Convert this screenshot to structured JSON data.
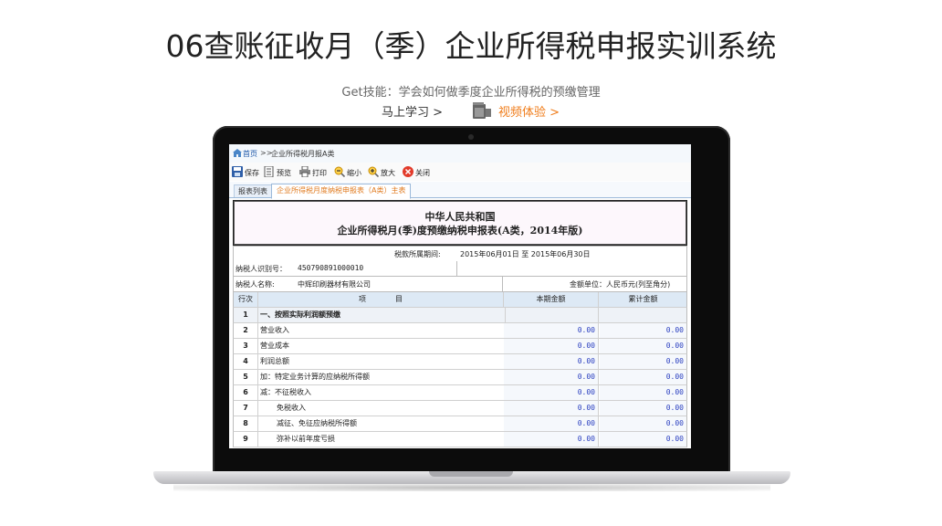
{
  "page": {
    "title": "06查账征收月（季）企业所得税申报实训系统",
    "subtitle": "Get技能：学会如何做季度企业所得税的预缴管理",
    "learn_link": "马上学习 >",
    "video_link": "视频体验 >"
  },
  "colors": {
    "accent": "#f07d1b",
    "link_blue": "#1b56a8",
    "amount_blue": "#2a3fc0"
  },
  "screen": {
    "breadcrumb": {
      "home": "首页",
      "sep": ">>",
      "path": "企业所得税月报A类"
    },
    "toolbar": [
      {
        "icon": "save-icon",
        "label": "保存"
      },
      {
        "icon": "preview-icon",
        "label": "预览"
      },
      {
        "icon": "print-icon",
        "label": "打印"
      },
      {
        "icon": "zoom-out-icon",
        "label": "缩小"
      },
      {
        "icon": "zoom-in-icon",
        "label": "放大"
      },
      {
        "icon": "close-icon",
        "label": "关闭"
      }
    ],
    "tabs": {
      "list": "报表列表",
      "active": "企业所得税月度纳税申报表（A类）主表"
    },
    "form": {
      "header1": "中华人民共和国",
      "header2": "企业所得税月(季)度预缴纳税申报表(A类，2014年版)",
      "period_label": "税款所属期间:",
      "period_value": "2015年06月01日  至  2015年06月30日",
      "taxid_label": "纳税人识别号：",
      "taxid_value": "450790891000010",
      "taxname_label": "纳税人名称:",
      "taxname_value": "中辉印刷器材有限公司",
      "unit_label": "金额单位：人民币元(列至角分)",
      "columns": {
        "row_no": "行次",
        "item": "项　　　　目",
        "current": "本期金额",
        "cumulative": "累计金额"
      },
      "rows": [
        {
          "no": "1",
          "item": "一、按照实际利润额预缴",
          "current": "",
          "cumulative": "",
          "section": true
        },
        {
          "no": "2",
          "item": "营业收入",
          "current": "0.00",
          "cumulative": "0.00"
        },
        {
          "no": "3",
          "item": "营业成本",
          "current": "0.00",
          "cumulative": "0.00"
        },
        {
          "no": "4",
          "item": "利润总额",
          "current": "0.00",
          "cumulative": "0.00"
        },
        {
          "no": "5",
          "item": "加：特定业务计算的应纳税所得额",
          "current": "0.00",
          "cumulative": "0.00"
        },
        {
          "no": "6",
          "item": "减：不征税收入",
          "current": "0.00",
          "cumulative": "0.00"
        },
        {
          "no": "7",
          "item": "免税收入",
          "current": "0.00",
          "cumulative": "0.00",
          "indent": true
        },
        {
          "no": "8",
          "item": "减征、免征应纳税所得额",
          "current": "0.00",
          "cumulative": "0.00",
          "indent": true
        },
        {
          "no": "9",
          "item": "弥补以前年度亏损",
          "current": "0.00",
          "cumulative": "0.00",
          "indent": true
        }
      ]
    }
  }
}
